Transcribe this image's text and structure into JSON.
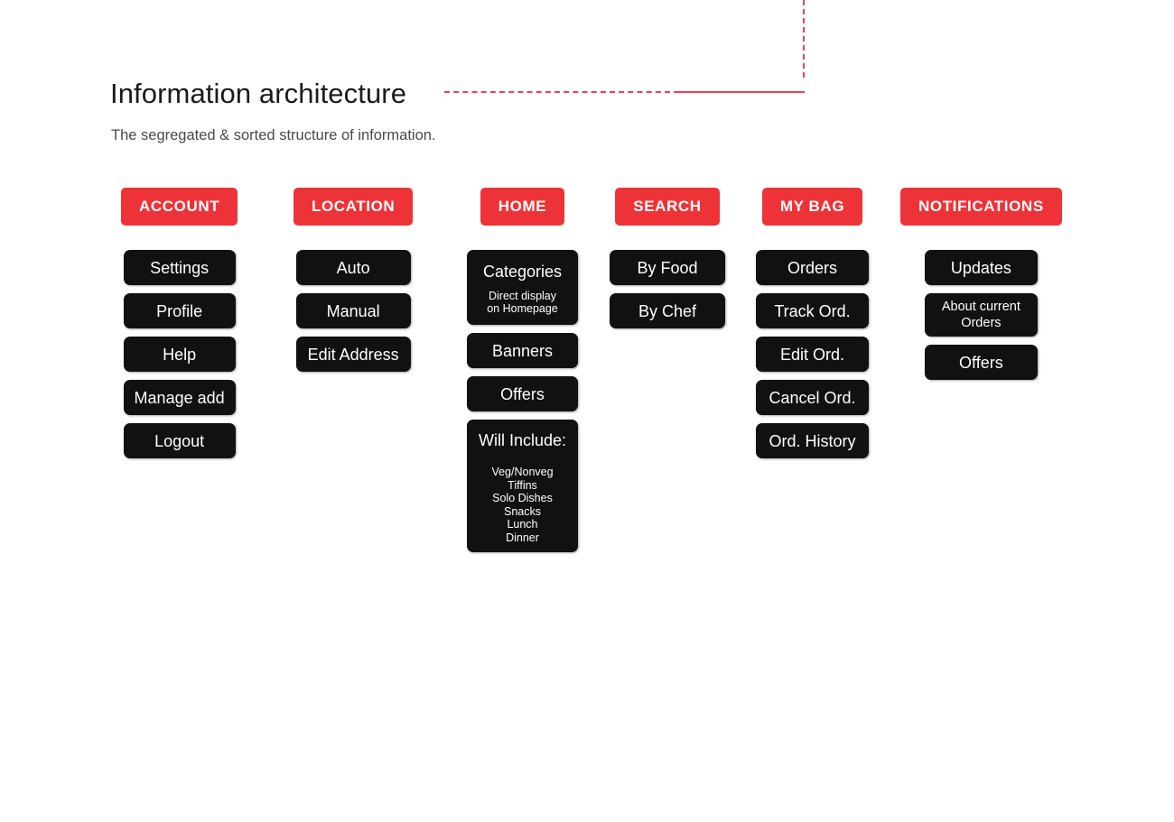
{
  "header": {
    "title": "Information architecture",
    "subtitle": "The segregated & sorted structure of information.",
    "accent_color": "#ee3338",
    "rule_color": "#ef4056"
  },
  "theme": {
    "header_button_bg": "#ee3338",
    "node_bg": "#111111",
    "node_text": "#ffffff",
    "page_bg": "#ffffff"
  },
  "columns": [
    {
      "header": "ACCOUNT",
      "nodes": [
        {
          "label": "Settings"
        },
        {
          "label": "Profile"
        },
        {
          "label": "Help"
        },
        {
          "label": "Manage add"
        },
        {
          "label": "Logout"
        }
      ]
    },
    {
      "header": "LOCATION",
      "nodes": [
        {
          "label": "Auto"
        },
        {
          "label": "Manual"
        },
        {
          "label": "Edit Address"
        }
      ]
    },
    {
      "header": "HOME",
      "nodes": [
        {
          "label": "Categories",
          "sub": "Direct display\non Homepage"
        },
        {
          "label": "Banners"
        },
        {
          "label": "Offers"
        },
        {
          "label": "Will Include:",
          "sub": "Veg/Nonveg\nTiffins\nSolo Dishes\nSnacks\nLunch\nDinner"
        }
      ]
    },
    {
      "header": "SEARCH",
      "nodes": [
        {
          "label": "By Food"
        },
        {
          "label": "By Chef"
        }
      ]
    },
    {
      "header": "MY BAG",
      "nodes": [
        {
          "label": "Orders"
        },
        {
          "label": "Track Ord."
        },
        {
          "label": "Edit Ord."
        },
        {
          "label": "Cancel Ord."
        },
        {
          "label": "Ord. History"
        }
      ]
    },
    {
      "header": "NOTIFICATIONS",
      "nodes": [
        {
          "label": "Updates"
        },
        {
          "label": "About current Orders"
        },
        {
          "label": "Offers"
        }
      ]
    }
  ]
}
